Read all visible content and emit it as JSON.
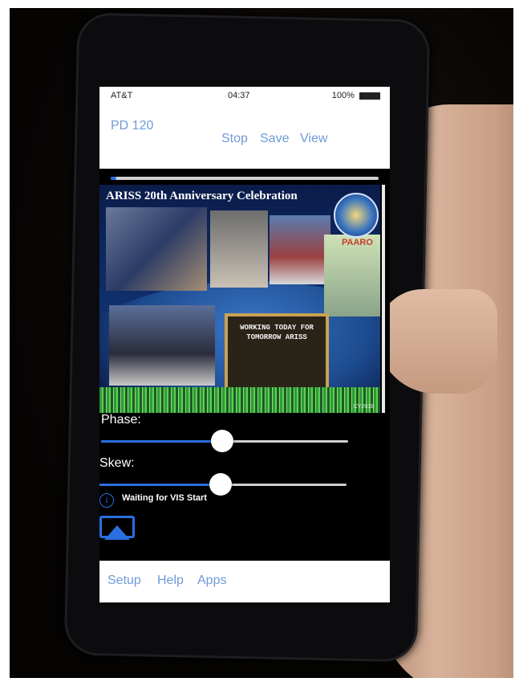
{
  "status": {
    "carrier": "AT&T",
    "time": "04:37",
    "battery": "100%"
  },
  "nav": {
    "left_label": "PD 120",
    "stop": "Stop",
    "save": "Save",
    "view": "View"
  },
  "progress": {
    "value": 0.02
  },
  "image": {
    "title": "ARISS 20th Anniversary Celebration",
    "patch_label": "PAARO",
    "sign_text": "WORKING TODAY FOR TOMORROW ARISS",
    "callsign": "CY2018"
  },
  "controls": {
    "phase_label": "Phase:",
    "phase_value": 0.49,
    "skew_label": "Skew:",
    "skew_value": 0.49
  },
  "status_message": "Waiting for VIS Start",
  "toolbar": {
    "setup": "Setup",
    "help": "Help",
    "apps": "Apps"
  },
  "colors": {
    "accent": "#2a6fe0",
    "link": "#6f9bd6"
  }
}
